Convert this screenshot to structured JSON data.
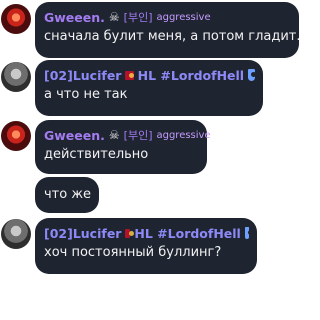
{
  "messages": [
    {
      "user": "Gweeen.",
      "icon": "☠",
      "tag": "[부인]",
      "badge": "aggressive",
      "text": "сначала булит меня, а потом гладит."
    },
    {
      "user": "[02]Lucifer",
      "tag": "HL #LordofHell",
      "text": "а что не так"
    },
    {
      "user": "Gweeen.",
      "icon": "☠",
      "tag": "[부인]",
      "badge": "aggressive",
      "text": "действительно"
    },
    {
      "text": "что же"
    },
    {
      "user": "[02]Lucifer",
      "tag": "HL #LordofHell",
      "text": "хоч постоянный буллинг?"
    }
  ]
}
